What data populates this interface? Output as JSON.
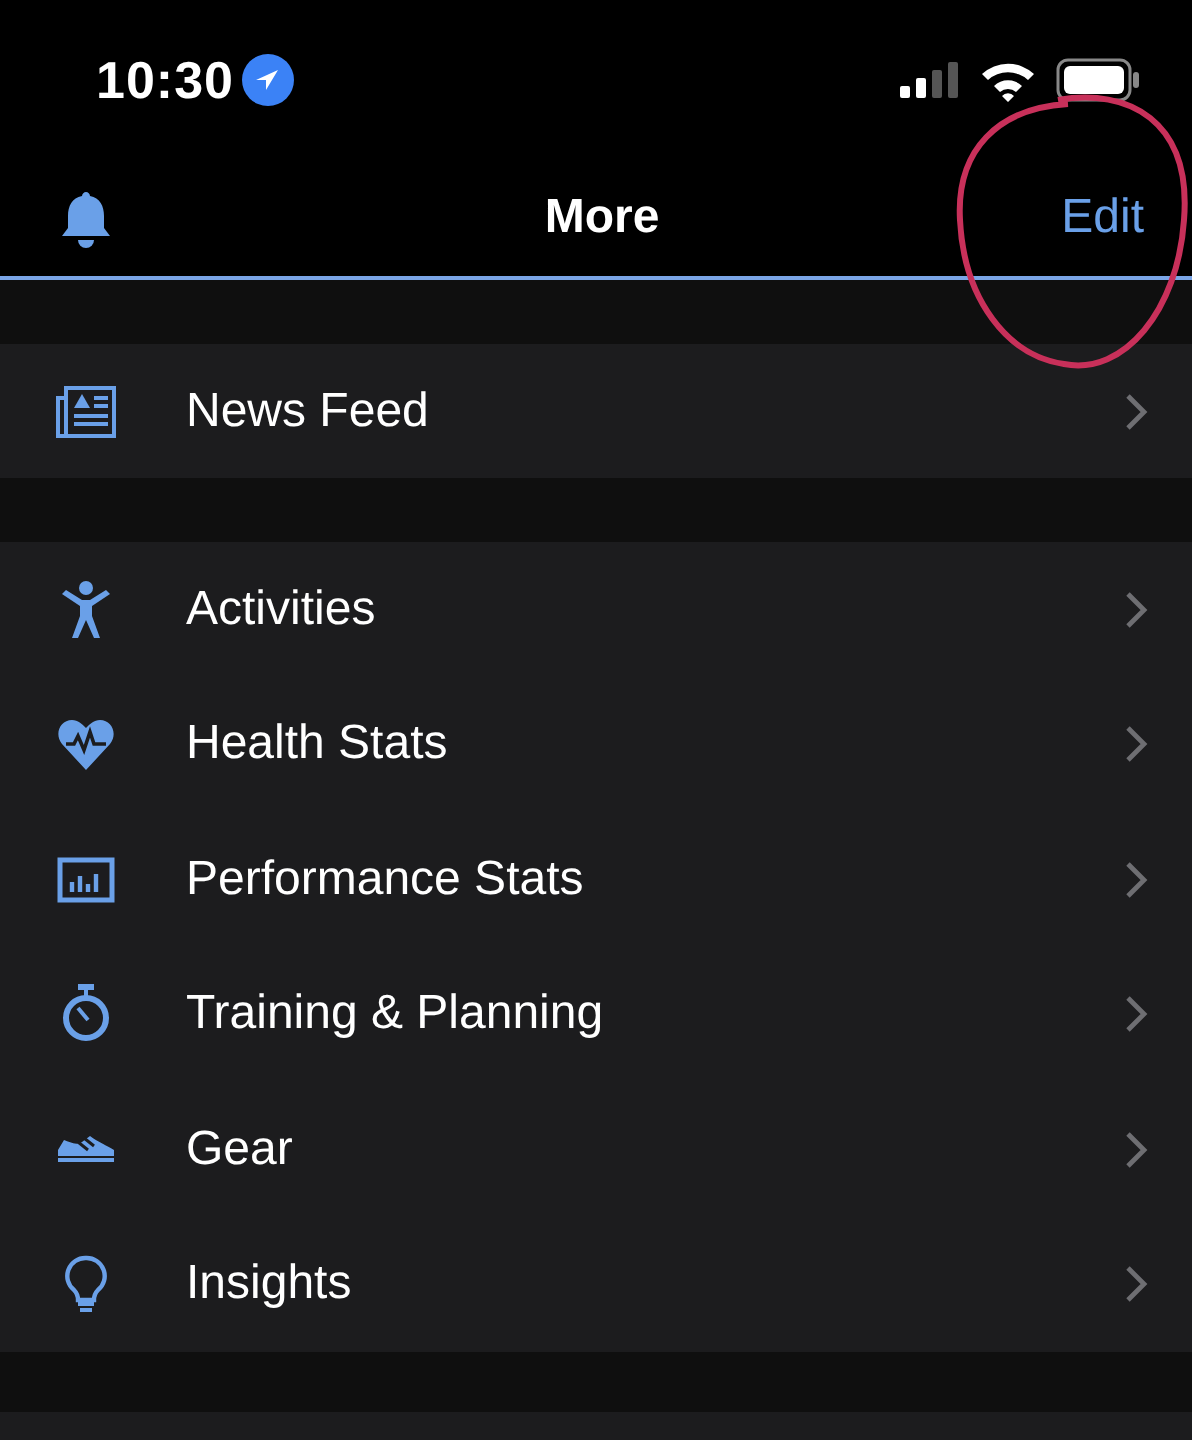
{
  "status_bar": {
    "time": "10:30"
  },
  "nav_bar": {
    "title": "More",
    "edit_button": "Edit"
  },
  "sections": [
    {
      "items": [
        {
          "label": "News Feed"
        }
      ]
    },
    {
      "items": [
        {
          "label": "Activities"
        },
        {
          "label": "Health Stats"
        },
        {
          "label": "Performance Stats"
        },
        {
          "label": "Training & Planning"
        },
        {
          "label": "Gear"
        },
        {
          "label": "Insights"
        }
      ]
    }
  ]
}
